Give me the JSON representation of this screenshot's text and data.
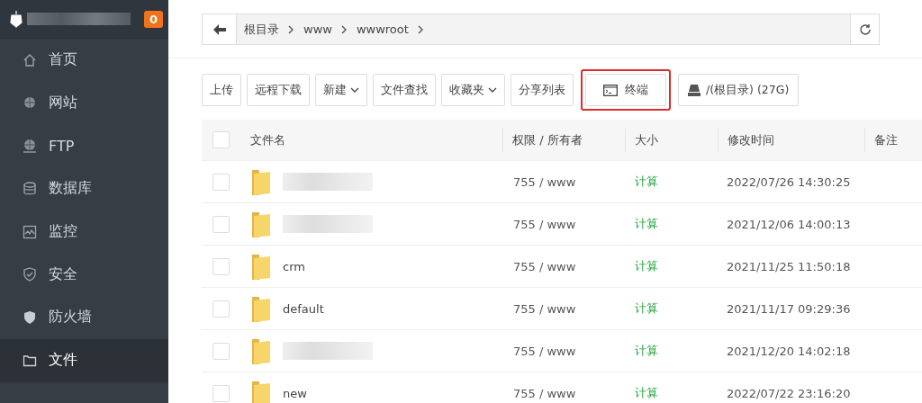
{
  "sidebar": {
    "badge": "0",
    "items": [
      {
        "label": "首页",
        "selected": false
      },
      {
        "label": "网站",
        "selected": false
      },
      {
        "label": "FTP",
        "selected": false
      },
      {
        "label": "数据库",
        "selected": false
      },
      {
        "label": "监控",
        "selected": false
      },
      {
        "label": "安全",
        "selected": false
      },
      {
        "label": "防火墙",
        "selected": false
      },
      {
        "label": "文件",
        "selected": true
      }
    ]
  },
  "path": {
    "crumbs": [
      "根目录",
      "www",
      "wwwroot"
    ]
  },
  "toolbar": [
    {
      "label": "上传",
      "kind": "plain",
      "highlighted": false
    },
    {
      "label": "远程下载",
      "kind": "plain",
      "highlighted": false
    },
    {
      "label": "新建",
      "kind": "dropdown",
      "highlighted": false
    },
    {
      "label": "文件查找",
      "kind": "plain",
      "highlighted": false
    },
    {
      "label": "收藏夹",
      "kind": "dropdown",
      "highlighted": false
    },
    {
      "label": "分享列表",
      "kind": "plain",
      "highlighted": false
    },
    {
      "label": "终端",
      "kind": "terminal",
      "highlighted": true
    },
    {
      "label": "/(根目录) (27G)",
      "kind": "disk",
      "highlighted": false
    }
  ],
  "table": {
    "all_checked": false,
    "columns": [
      "文件名",
      "权限 / 所有者",
      "大小",
      "修改时间",
      "备注"
    ],
    "rows": [
      {
        "redacted": true,
        "perm": "755 / www",
        "size": "计算",
        "mtime": "2022/07/26 14:30:25",
        "checked": false
      },
      {
        "redacted": true,
        "perm": "755 / www",
        "size": "计算",
        "mtime": "2021/12/06 14:00:13",
        "checked": false
      },
      {
        "name": "crm",
        "redacted": false,
        "perm": "755 / www",
        "size": "计算",
        "mtime": "2021/11/25 11:50:18",
        "checked": false
      },
      {
        "name": "default",
        "redacted": false,
        "perm": "755 / www",
        "size": "计算",
        "mtime": "2021/11/17 09:29:36",
        "checked": false
      },
      {
        "redacted": true,
        "perm": "755 / www",
        "size": "计算",
        "mtime": "2021/12/20 14:02:18",
        "checked": false
      },
      {
        "name": "new",
        "redacted": false,
        "perm": "755 / www",
        "size": "计算",
        "mtime": "2022/07/22 23:16:20",
        "checked": false
      }
    ]
  }
}
